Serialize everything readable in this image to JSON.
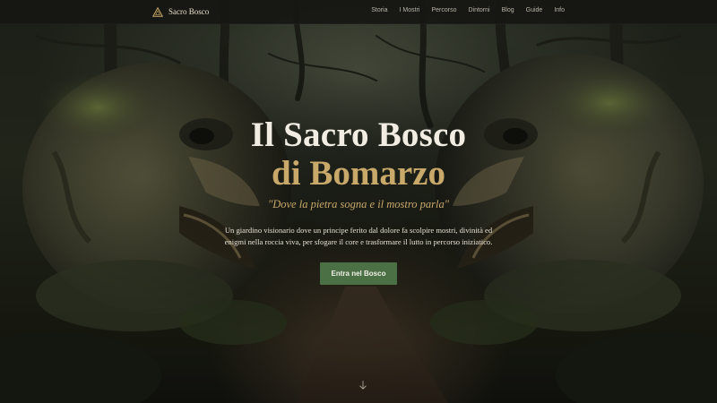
{
  "nav": {
    "brand": "Sacro Bosco",
    "logo_icon": "triangle-logo-icon",
    "links": [
      "Storia",
      "I Mostri",
      "Percorso",
      "Dintorni",
      "Blog",
      "Guide",
      "Info"
    ]
  },
  "hero": {
    "title_line1": "Il Sacro Bosco",
    "title_line2": "di Bomarzo",
    "tagline": "\"Dove la pietra sogna e il mostro parla\"",
    "description_line1": "Un giardino visionario dove un principe ferito dal dolore fa scolpire mostri, divinità ed",
    "description_line2": "enigmi nella roccia viva, per sfogare il core e trasformare il lutto in percorso iniziatico.",
    "cta_label": "Entra nel Bosco",
    "scroll_icon": "arrow-down-icon"
  },
  "colors": {
    "accent_gold": "#c8a96a",
    "button_green": "#4c7046",
    "nav_bg": "#161612",
    "title_white": "#f2ede2"
  }
}
